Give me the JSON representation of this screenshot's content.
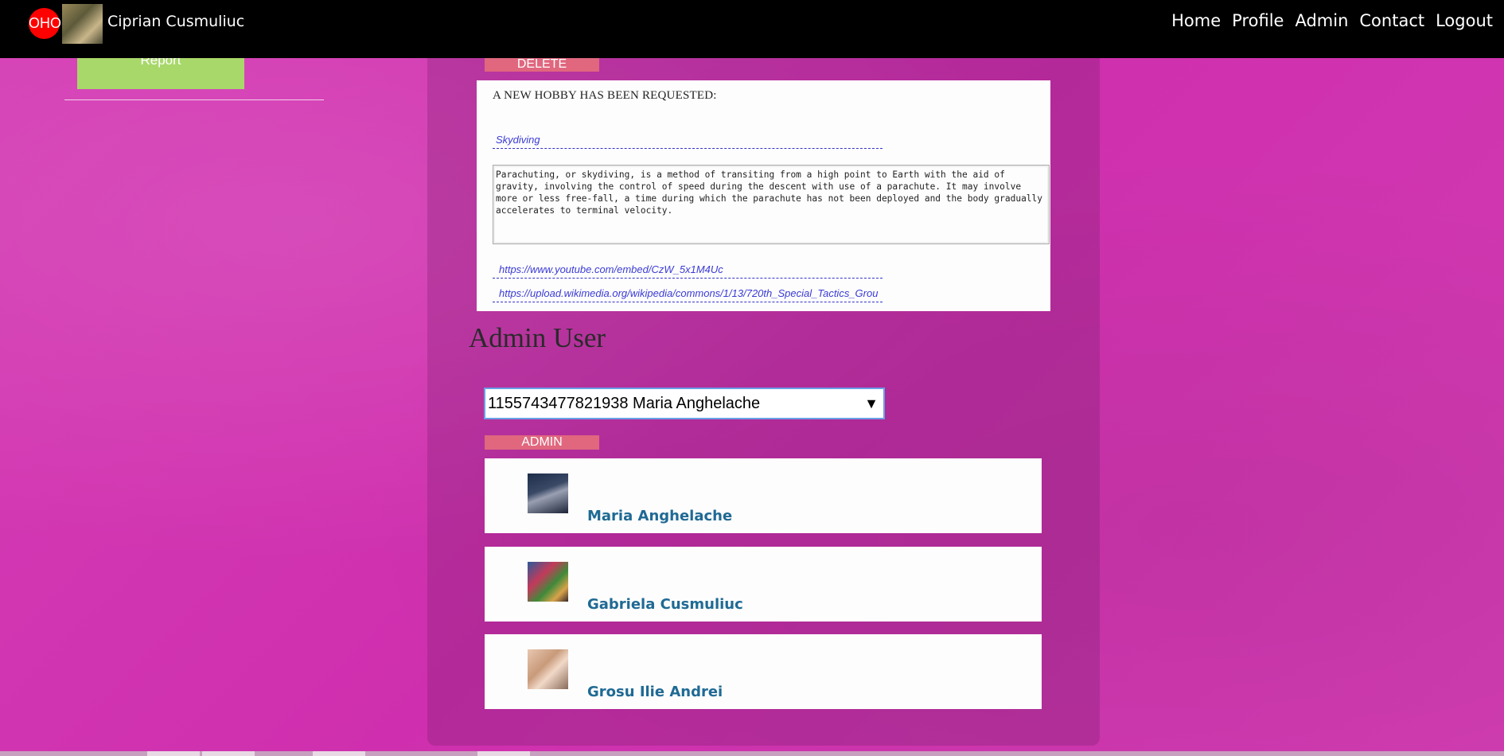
{
  "topbar": {
    "logo_text": "OHO",
    "user_name": "Ciprian Cusmuliuc",
    "nav": [
      "Home",
      "Profile",
      "Admin",
      "Contact",
      "Logout"
    ]
  },
  "sidebar": {
    "report_button_label": "Report"
  },
  "hobby_request": {
    "delete_label": "DELETE",
    "title": "A NEW HOBBY HAS BEEN REQUESTED:",
    "hobby_name": "Skydiving",
    "description": "Parachuting, or skydiving, is a method of transiting from a high point to Earth with the aid of gravity, involving the control of speed during the descent with use of a parachute. It may involve more or less free-fall, a time during which the parachute has not been deployed and the body gradually accelerates to terminal velocity.",
    "video_url": "https://www.youtube.com/embed/CzW_5x1M4Uc",
    "image_url": "https://upload.wikimedia.org/wikipedia/commons/1/13/720th_Special_Tactics_Grou"
  },
  "admin_user": {
    "title": "Admin User",
    "selected_user": "1155743477821938 Maria Anghelache",
    "admin_label": "ADMIN",
    "users": [
      {
        "name": "Maria Anghelache"
      },
      {
        "name": "Gabriela Cusmuliuc"
      },
      {
        "name": "Grosu Ilie Andrei"
      }
    ]
  },
  "colors": {
    "background": "#d437b0",
    "topbar": "#000000",
    "report_button": "#a8d86a",
    "small_button": "#e0677e",
    "user_name_link": "#1f6a94",
    "input_text": "#3a3ad6"
  }
}
